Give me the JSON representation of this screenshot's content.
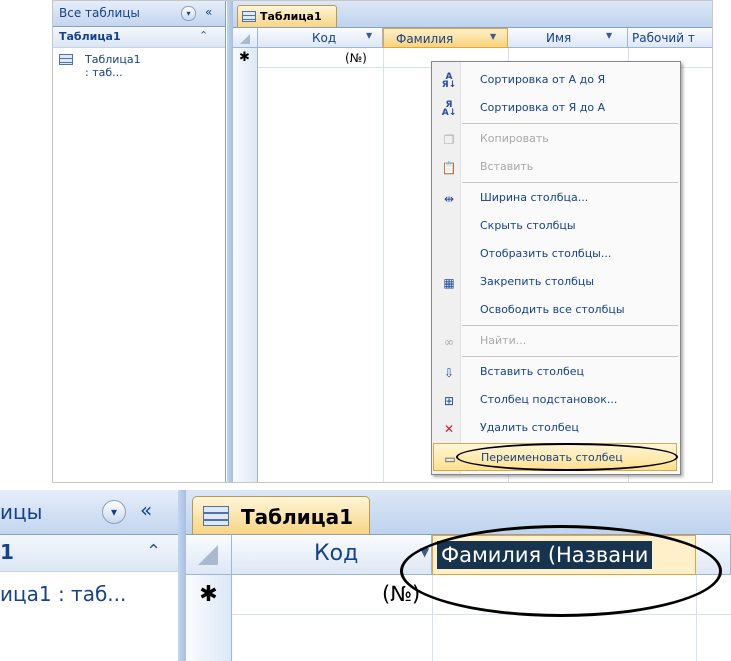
{
  "nav": {
    "header": "Все таблицы",
    "group": "Таблица1",
    "item": "Таблица1 : таб...",
    "dropdown_icon": "chevron-down-icon",
    "collapse_icon": "double-left-icon",
    "group_collapse_icon": "double-up-icon"
  },
  "tab": {
    "label": "Таблица1"
  },
  "grid": {
    "columns": [
      "Код",
      "Фамилия",
      "Имя",
      "Рабочий т"
    ],
    "new_row_marker": "✱",
    "new_row_value": "(№)"
  },
  "menu": {
    "items": [
      {
        "label": "Сортировка от А до Я",
        "icon": "sort-az-icon",
        "enabled": true
      },
      {
        "label": "Сортировка от Я до А",
        "icon": "sort-za-icon",
        "enabled": true
      },
      {
        "label": "Копировать",
        "icon": "copy-icon",
        "enabled": false
      },
      {
        "label": "Вставить",
        "icon": "paste-icon",
        "enabled": false
      },
      {
        "label": "Ширина столбца...",
        "icon": "column-width-icon",
        "enabled": true
      },
      {
        "label": "Скрыть столбцы",
        "icon": "",
        "enabled": true
      },
      {
        "label": "Отобразить столбцы...",
        "icon": "",
        "enabled": true
      },
      {
        "label": "Закрепить столбцы",
        "icon": "freeze-columns-icon",
        "enabled": true
      },
      {
        "label": "Освободить все столбцы",
        "icon": "",
        "enabled": true
      },
      {
        "label": "Найти...",
        "icon": "binoculars-icon",
        "enabled": false
      },
      {
        "label": "Вставить столбец",
        "icon": "insert-column-icon",
        "enabled": true
      },
      {
        "label": "Столбец подстановок...",
        "icon": "lookup-column-icon",
        "enabled": true
      },
      {
        "label": "Удалить столбец",
        "icon": "delete-column-icon",
        "enabled": true
      },
      {
        "label": "Переименовать столбец",
        "icon": "rename-column-icon",
        "enabled": true
      }
    ]
  },
  "zoom": {
    "nav_header": "ицы",
    "nav_group": "1",
    "nav_item": "ица1 : таб...",
    "tab": "Таблица1",
    "col_kod": "Код",
    "edit_value": "Фамилия (Названи",
    "new_row_marker": "✱",
    "new_row_value": "(№)"
  },
  "colors": {
    "accent": "#15428b",
    "tab_active": "#f7d583",
    "highlight_border": "#e7a43a",
    "edit_bg": "#17344f"
  }
}
